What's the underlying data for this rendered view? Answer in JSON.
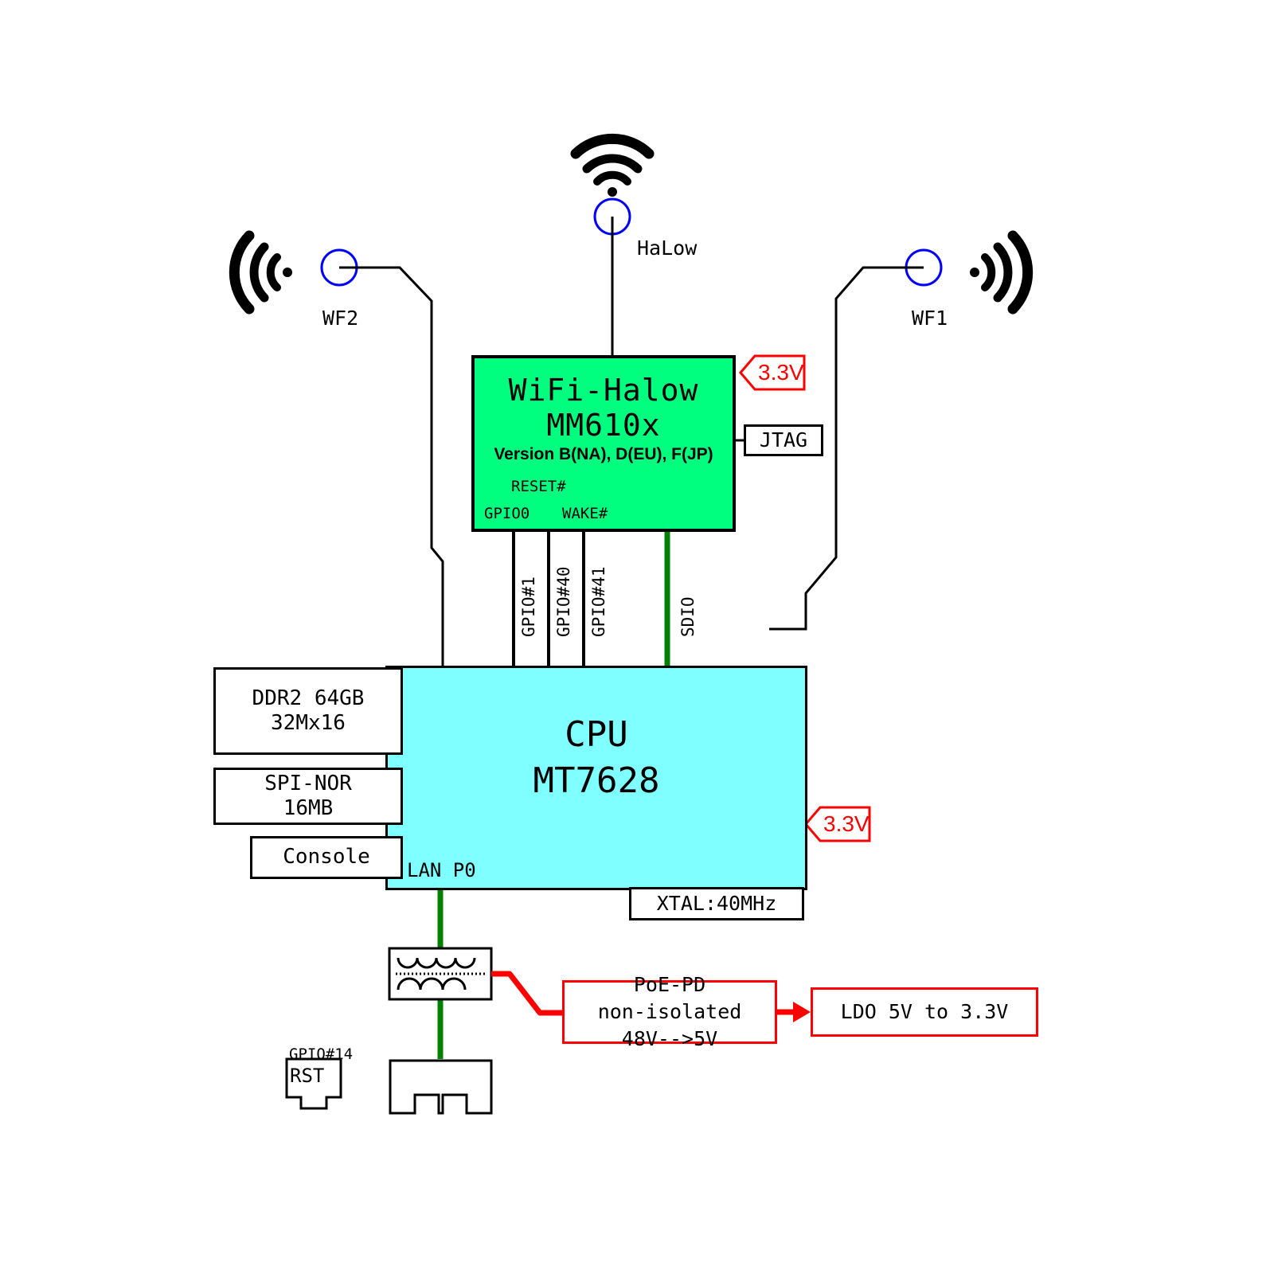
{
  "diagram": {
    "title": "WiFi-HaLow gateway block diagram",
    "colors": {
      "halow_fill": "#00ff7f",
      "cpu_fill": "#7fffff",
      "power_red": "#ff0000",
      "signal_green": "#008000",
      "antenna_node_blue": "#0000ff",
      "outline_black": "#000000"
    }
  },
  "antennas": [
    {
      "id": "wf2",
      "label": "WF2",
      "icon": "wifi-antenna-icon"
    },
    {
      "id": "halow",
      "label": "HaLow",
      "icon": "wifi-antenna-icon"
    },
    {
      "id": "wf1",
      "label": "WF1",
      "icon": "wifi-antenna-icon"
    }
  ],
  "halow": {
    "title": "WiFi-Halow",
    "part": "MM610x",
    "version": "Version B(NA), D(EU), F(JP)",
    "pins": {
      "reset": "RESET#",
      "gpio0": "GPIO0",
      "wake": "WAKE#"
    },
    "power_tag": "3.3V",
    "jtag": "JTAG"
  },
  "cpu": {
    "title": "CPU",
    "part": "MT7628",
    "lan_port": "LAN P0",
    "power_tag": "3.3V",
    "xtal": "XTAL:40MHz"
  },
  "buses": [
    {
      "name": "GPIO#1",
      "color": "#000000"
    },
    {
      "name": "GPIO#40",
      "color": "#000000"
    },
    {
      "name": "GPIO#41",
      "color": "#000000"
    },
    {
      "name": "SDIO",
      "color": "#008000"
    }
  ],
  "peripherals": [
    {
      "id": "ddr2",
      "line1": "DDR2 64GB",
      "line2": "32Mx16"
    },
    {
      "id": "spi-nor",
      "line1": "SPI-NOR",
      "line2": "16MB"
    },
    {
      "id": "console",
      "line1": "Console",
      "line2": ""
    }
  ],
  "power_chain": {
    "poe": {
      "line1": "PoE-PD",
      "line2": "non-isolated",
      "line3": "48V-->5V"
    },
    "ldo": {
      "line1": "LDO 5V to 3.3V"
    }
  },
  "reset_button": {
    "gpio": "GPIO#14",
    "label": "RST"
  },
  "connectors": {
    "magnetics": "ethernet-magnetics-transformer",
    "rj45": "rj45-jack"
  }
}
